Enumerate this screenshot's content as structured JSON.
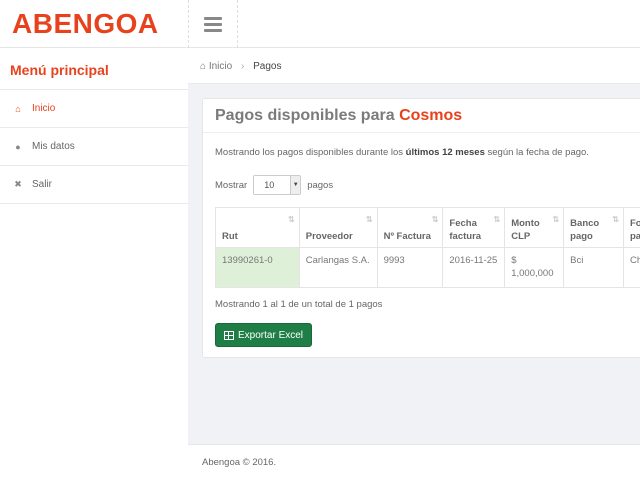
{
  "brand": {
    "logo_text": "ABENGOA",
    "accent_color": "#e8421d"
  },
  "topbar": {
    "menu_icon": "hamburger-icon"
  },
  "sidebar": {
    "title": "Menú principal",
    "items": [
      {
        "label": "Inicio",
        "icon": "home-icon",
        "active": true
      },
      {
        "label": "Mis datos",
        "icon": "user-icon",
        "active": false
      },
      {
        "label": "Salir",
        "icon": "close-icon",
        "active": false
      }
    ]
  },
  "breadcrumb": {
    "home": "Inicio",
    "separator": "›",
    "current": "Pagos"
  },
  "panel": {
    "title_prefix": "Pagos disponibles para",
    "title_accent": "Cosmos",
    "desc_prefix": "Mostrando los pagos disponibles durante los",
    "desc_bold": "últimos 12 meses",
    "desc_suffix": "según la fecha de pago.",
    "show_label": "Mostrar",
    "show_value": "10",
    "show_suffix": "pagos",
    "summary": "Mostrando 1 al 1 de un total de 1 pagos",
    "export_label": "Exportar Excel"
  },
  "table": {
    "headers": [
      "Rut",
      "Proveedor",
      "Nº Factura",
      "Fecha factura",
      "Monto CLP",
      "Banco pago",
      "Fo pa"
    ],
    "rows": [
      [
        "13990261-0",
        "Carlangas S.A.",
        "9993",
        "2016-11-25",
        "$ 1,000,000",
        "Bci",
        "Ch"
      ]
    ]
  },
  "footer": {
    "text": "Abengoa © 2016."
  }
}
